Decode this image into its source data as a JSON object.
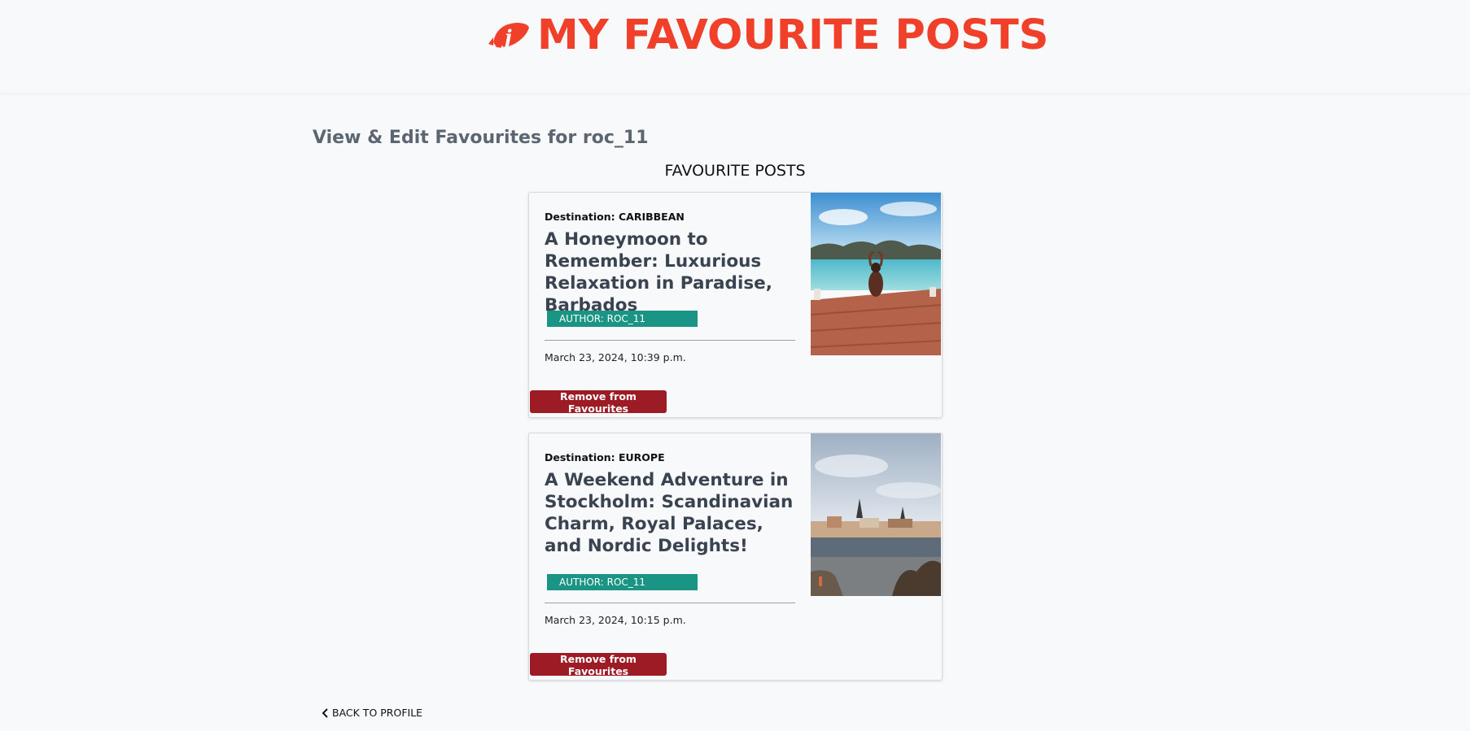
{
  "header": {
    "title": "MY FAVOURITE POSTS",
    "logo_icon": "jellyfish-logo-icon",
    "brand_color": "#f0402a"
  },
  "page": {
    "heading": "View & Edit Favourites for roc_11",
    "section_title": "FAVOURITE POSTS"
  },
  "posts": [
    {
      "destination": "Destination: CARIBBEAN",
      "title": "A Honeymoon to Remember: Luxurious Relaxation in Paradise, Barbados",
      "author": "AUTHOR: ROC_11",
      "date": "March 23, 2024, 10:39 p.m.",
      "remove_label": "Remove from Favourites",
      "image": "beach-pier-photo"
    },
    {
      "destination": "Destination: EUROPE",
      "title": "A Weekend Adventure in Stockholm: Scandinavian Charm, Royal Palaces, and Nordic Delights!",
      "author": "AUTHOR: ROC_11",
      "date": "March 23, 2024, 10:15 p.m.",
      "remove_label": "Remove from Favourites",
      "image": "stockholm-city-photo"
    }
  ],
  "footer": {
    "back_label": "BACK TO PROFILE",
    "back_icon": "chevron-left-icon"
  },
  "colors": {
    "author_badge": "#1a9484",
    "remove_button": "#9c1b24",
    "heading_gray": "#5c6670"
  }
}
